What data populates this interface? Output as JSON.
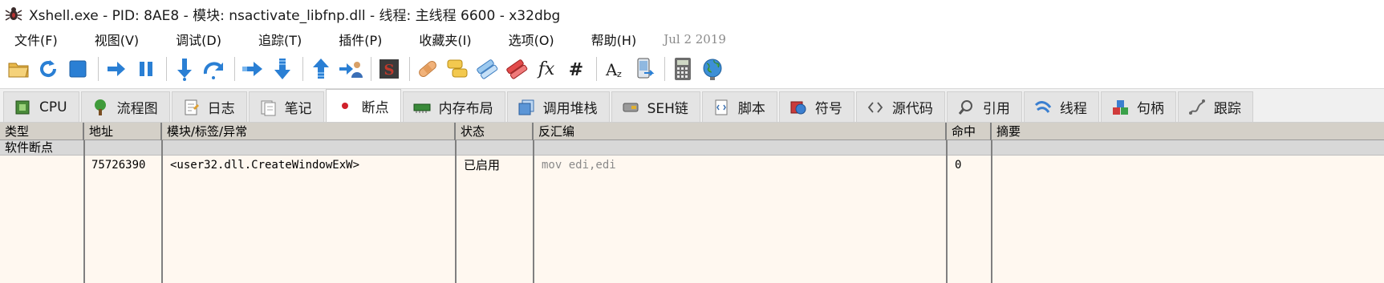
{
  "window": {
    "title": "Xshell.exe - PID: 8AE8 - 模块: nsactivate_libfnp.dll - 线程: 主线程 6600 - x32dbg",
    "app_icon": "bug-icon"
  },
  "menu": {
    "items": [
      "文件(F)",
      "视图(V)",
      "调试(D)",
      "追踪(T)",
      "插件(P)",
      "收藏夹(I)",
      "选项(O)",
      "帮助(H)"
    ],
    "date": "Jul 2 2019"
  },
  "toolbar": {
    "buttons": [
      "open-folder-icon",
      "restart-icon",
      "stop-icon",
      "run-icon",
      "pause-icon",
      "step-into-icon",
      "step-over-icon",
      "trace-into-icon",
      "trace-over-icon",
      "execute-till-return-icon",
      "run-to-user-code-icon",
      "scylla-icon",
      "patch-icon",
      "comments-icon",
      "labels-icon",
      "bookmarks-icon",
      "function-icon",
      "hash-icon",
      "font-icon",
      "device-icon",
      "calculator-icon",
      "globe-icon"
    ]
  },
  "tabs": [
    {
      "label": "CPU",
      "icon": "cpu-icon"
    },
    {
      "label": "流程图",
      "icon": "graph-tree-icon"
    },
    {
      "label": "日志",
      "icon": "log-icon"
    },
    {
      "label": "笔记",
      "icon": "notes-icon"
    },
    {
      "label": "断点",
      "icon": "breakpoint-icon",
      "active": true
    },
    {
      "label": "内存布局",
      "icon": "memory-map-icon"
    },
    {
      "label": "调用堆栈",
      "icon": "call-stack-icon"
    },
    {
      "label": "SEH链",
      "icon": "seh-chain-icon"
    },
    {
      "label": "脚本",
      "icon": "script-icon"
    },
    {
      "label": "符号",
      "icon": "symbols-icon"
    },
    {
      "label": "源代码",
      "icon": "source-icon"
    },
    {
      "label": "引用",
      "icon": "references-icon"
    },
    {
      "label": "线程",
      "icon": "threads-icon"
    },
    {
      "label": "句柄",
      "icon": "handles-icon"
    },
    {
      "label": "跟踪",
      "icon": "trace-icon"
    }
  ],
  "table": {
    "columns": [
      "类型",
      "地址",
      "模块/标签/异常",
      "状态",
      "反汇编",
      "命中",
      "摘要"
    ],
    "group": "软件断点",
    "rows": [
      {
        "type": "",
        "address": "75726390",
        "label": "<user32.dll.CreateWindowExW>",
        "status": "已启用",
        "disasm": "mov edi,edi",
        "hits": "0",
        "summary": ""
      }
    ]
  },
  "colors": {
    "table_bg": "#fff8f0",
    "header_bg": "#d4d0c8",
    "group_bg": "#d8d8d8",
    "disasm_text": "#8a8a8a"
  }
}
